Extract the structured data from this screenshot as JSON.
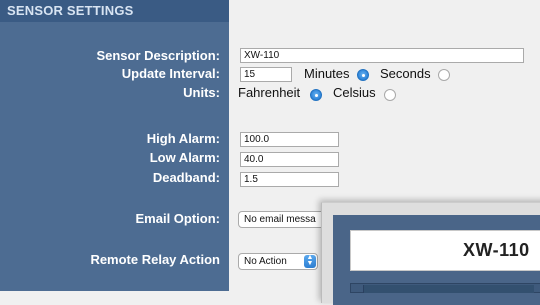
{
  "section": {
    "title": "SENSOR SETTINGS"
  },
  "labels": {
    "sensor_description": "Sensor Description:",
    "update_interval": "Update Interval:",
    "units": "Units:",
    "high_alarm": "High Alarm:",
    "low_alarm": "Low Alarm:",
    "deadband": "Deadband:",
    "email_option": "Email Option:",
    "remote_relay_action": "Remote Relay Action"
  },
  "fields": {
    "sensor_description": "XW-110",
    "update_interval": "15",
    "high_alarm": "100.0",
    "low_alarm": "40.0",
    "deadband": "1.5"
  },
  "interval_units": {
    "options": [
      "Minutes",
      "Seconds"
    ],
    "selected": "Minutes"
  },
  "temperature_units": {
    "options": [
      "Fahrenheit",
      "Celsius"
    ],
    "selected": "Fahrenheit"
  },
  "email_option": {
    "selected": "No email messa"
  },
  "remote_relay_action": {
    "selected": "No Action"
  },
  "overlay": {
    "title": "XW-110"
  },
  "colors": {
    "label_column": "#4d6c92",
    "section_header": "#3a5b84",
    "radio_selected": "#2c82d8",
    "background": "#f0f0f0"
  }
}
